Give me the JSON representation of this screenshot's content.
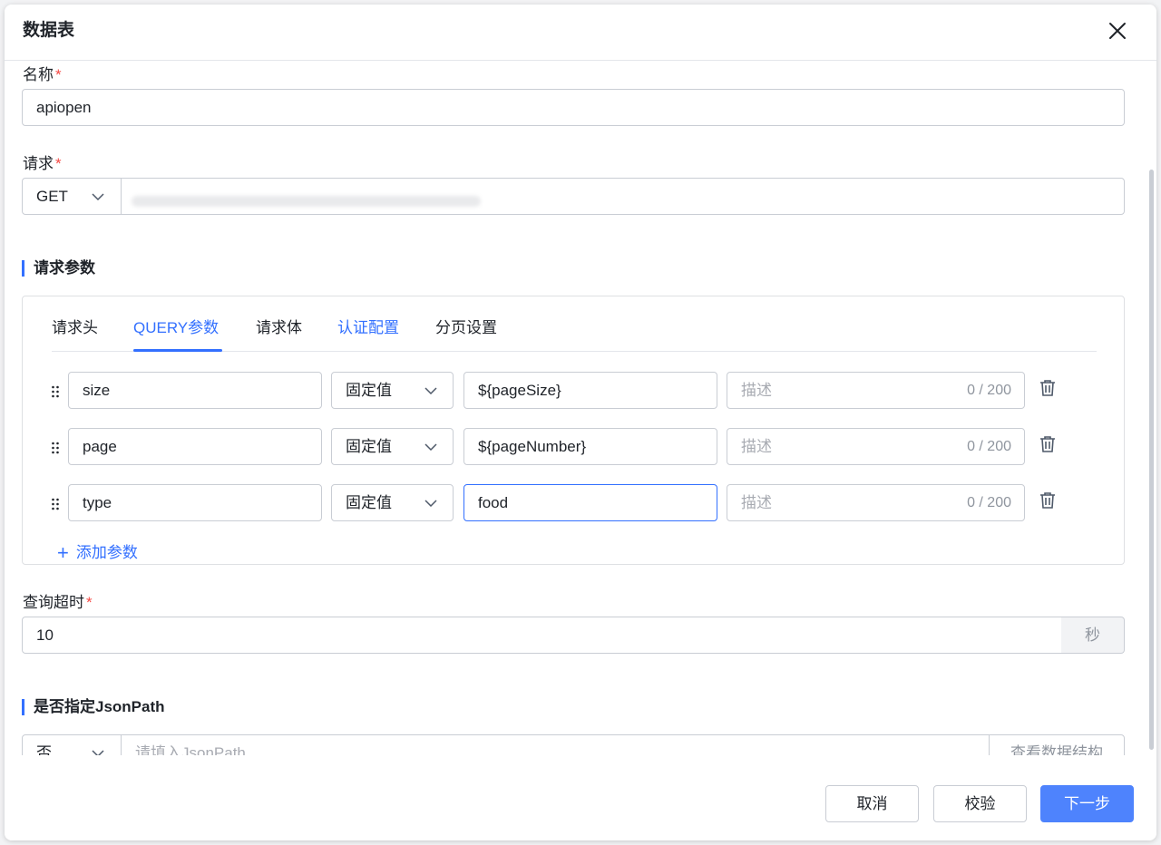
{
  "dialog": {
    "title": "数据表"
  },
  "form": {
    "name": {
      "label": "名称",
      "required_mark": "*",
      "value": "apiopen"
    },
    "request": {
      "label": "请求",
      "required_mark": "*",
      "method": "GET",
      "url": ""
    },
    "params_section": {
      "title": "请求参数"
    },
    "tabs": [
      {
        "label": "请求头"
      },
      {
        "label": "QUERY参数"
      },
      {
        "label": "请求体"
      },
      {
        "label": "认证配置"
      },
      {
        "label": "分页设置"
      }
    ],
    "active_tab": "QUERY参数",
    "params": [
      {
        "key": "size",
        "type": "固定值",
        "value": "${pageSize}",
        "desc_placeholder": "描述",
        "counter": "0 / 200"
      },
      {
        "key": "page",
        "type": "固定值",
        "value": "${pageNumber}",
        "desc_placeholder": "描述",
        "counter": "0 / 200"
      },
      {
        "key": "type",
        "type": "固定值",
        "value": "food",
        "desc_placeholder": "描述",
        "counter": "0 / 200"
      }
    ],
    "add_param_label": "添加参数",
    "timeout": {
      "label": "查询超时",
      "required_mark": "*",
      "value": "10",
      "unit": "秒"
    },
    "jsonpath_section": {
      "title": "是否指定JsonPath"
    },
    "jsonpath": {
      "select": "否",
      "placeholder": "请填入JsonPath",
      "view_button": "查看数据结构"
    }
  },
  "footer": {
    "cancel": "取消",
    "validate": "校验",
    "next": "下一步"
  },
  "colors": {
    "primary": "#3370ff",
    "button_primary": "#4e83fd",
    "required": "#f54a45",
    "border": "#c9cdd4"
  },
  "icons": [
    "close-icon",
    "chevron-down-icon",
    "drag-handle-icon",
    "trash-icon",
    "plus-icon"
  ]
}
